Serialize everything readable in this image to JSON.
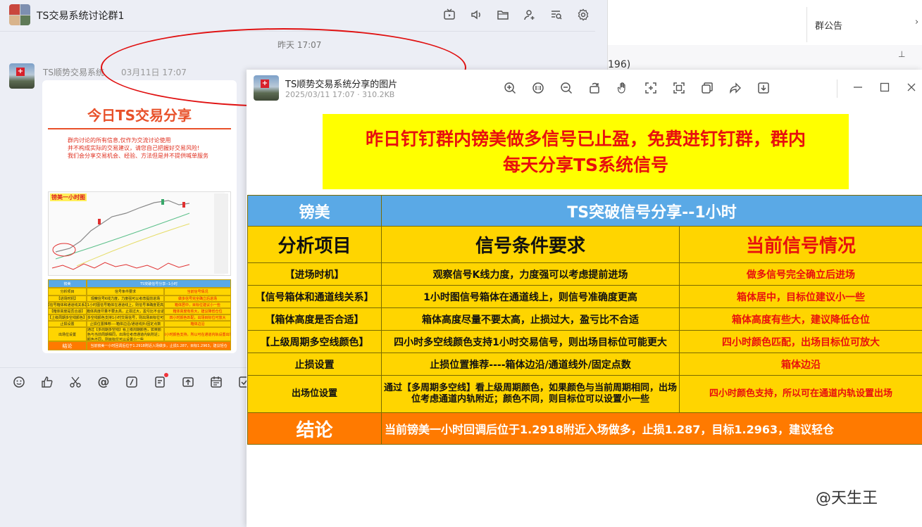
{
  "chat": {
    "title": "TS交易系统讨论群1",
    "time_separator": "昨天 17:07",
    "sender_name": "TS顺势交易系统",
    "sender_time": "03月11日 17:07",
    "header_icons": [
      "tv-icon",
      "speaker-icon",
      "folder-icon",
      "add-member-icon",
      "search-history-icon",
      "settings-icon"
    ],
    "toolbar_icons": [
      "emoji-icon",
      "thumbs-up-icon",
      "scissors-icon",
      "at-icon",
      "slash-icon",
      "note-icon",
      "upload-icon",
      "calendar-icon",
      "checkbox-icon"
    ]
  },
  "thumbnail": {
    "title": "今日TS交易分享",
    "note_lines": [
      "群内讨论的所有信息,仅作为交流讨论使用",
      "并不构成实际的交易建议，请您自己把握好交易风险!",
      "我们会分享交易机会、经验、方法但是并不提供喊单服务"
    ],
    "chart_label": "镑美一小时图",
    "table_rows": [
      [
        "镑美",
        "TS突破信号分享--1小时",
        ""
      ],
      [
        "分析项目",
        "信号条件要求",
        "当前信号情况"
      ],
      [
        "【进场时机】",
        "观察信号K线力度，力度强可以考虑提前进场",
        "做多信号完全确立后进场"
      ],
      [
        "【信号箱体和通道线关系】",
        "1小时图信号箱体在通道线上，则信号准确度更高",
        "箱体居中，目标位建议小一些"
      ],
      [
        "【箱体高度是否合适】",
        "箱体高度尽量不要太高，止损过大，盈亏比不合适",
        "箱体高度有些大，建议降低仓位"
      ],
      [
        "【上级周期多空线颜色】",
        "四小时多空线颜色支持1小时交易信号，则出场目标位可能更大",
        "四小时颜色匹配，出场目标位可放大"
      ],
      [
        "止损设置",
        "止损位置推荐----箱体边沿/通道线外/固定点数",
        "箱体边沿"
      ],
      [
        "出场位设置",
        "通过【多周期多空线】看上级周期颜色，如果颜色与当前周期相同，出场位考虑通道内轨附近；颜色不同，则目标位可以设置小一些",
        "四小时颜色支持，所以可在通道内轨设置出场"
      ],
      [
        "结论",
        "当前镑美一小时回调后位于1.2918附近入场做多，止损1.287，目标1.2963，建议轻仓",
        ""
      ]
    ]
  },
  "background_window": {
    "notice_label": "群公告",
    "partial_text": "196)"
  },
  "viewer": {
    "title": "TS顺势交易系统分享的图片",
    "meta": "2025/03/11 17:07 · 310.2KB",
    "tools": [
      "zoom-in-icon",
      "actual-size-icon",
      "zoom-out-icon",
      "rotate-icon",
      "hand-icon",
      "crop-icon",
      "ocr-icon",
      "copy-icon",
      "share-icon",
      "download-icon"
    ],
    "window_controls": [
      "minimize-icon",
      "maximize-icon",
      "close-icon"
    ]
  },
  "poster": {
    "banner_line1": "昨日钉钉群内镑美做多信号已止盈，免费进钉钉群，群内",
    "banner_line2": "每天分享TS系统信号",
    "header_pair": "镑美",
    "header_title": "TS突破信号分享--1小时",
    "col1": "分析项目",
    "col2": "信号条件要求",
    "col3": "当前信号情况",
    "rows": [
      {
        "item": "【进场时机】",
        "condition": "观察信号K线力度，力度强可以考虑提前进场",
        "status": "做多信号完全确立后进场"
      },
      {
        "item": "【信号箱体和通道线关系】",
        "condition": "1小时图信号箱体在通道线上，则信号准确度更高",
        "status": "箱体居中，目标位建议小一些"
      },
      {
        "item": "【箱体高度是否合适】",
        "condition": "箱体高度尽量不要太高，止损过大，盈亏比不合适",
        "status": "箱体高度有些大，建议降低仓位"
      },
      {
        "item": "【上级周期多空线颜色】",
        "condition": "四小时多空线颜色支持1小时交易信号，则出场目标位可能更大",
        "status": "四小时颜色匹配，出场目标位可放大"
      },
      {
        "item": "止损设置",
        "condition": "止损位置推荐----箱体边沿/通道线外/固定点数",
        "status": "箱体边沿"
      },
      {
        "item": "出场位设置",
        "condition": "通过【多周期多空线】看上级周期颜色，如果颜色与当前周期相同，出场位考虑通道内轨附近；颜色不同，则目标位可以设置小一些",
        "status": "四小时颜色支持，所以可在通道内轨设置出场"
      }
    ],
    "conclusion_label": "结论",
    "conclusion_text": "当前镑美一小时回调后位于1.2918附近入场做多，止损1.287，目标1.2963，建议轻仓"
  },
  "watermark": "@天生王",
  "colors": {
    "annotation_ellipse": "#e01010",
    "banner_bg": "#ffff00",
    "banner_text": "#e8100e",
    "table_header_bg": "#5aa9e6",
    "table_body_bg": "#ffd500",
    "conclusion_bg": "#ff7a00"
  }
}
